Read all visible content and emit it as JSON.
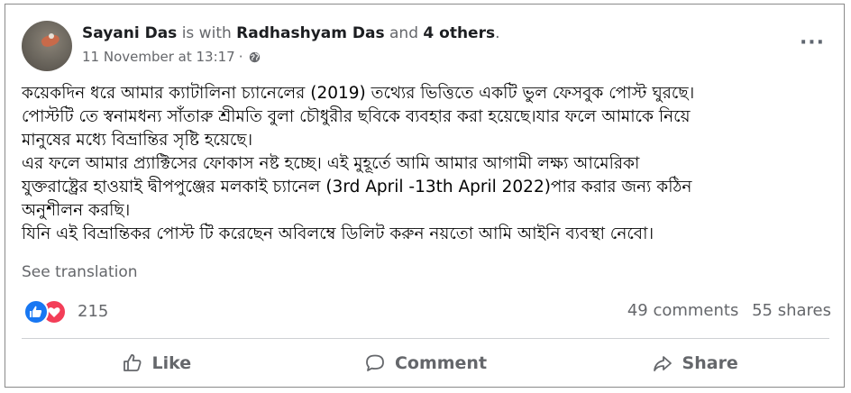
{
  "post": {
    "author": "Sayani Das",
    "with_text": "is with",
    "tagged_person": "Radhashyam Das",
    "and_text": "and",
    "others": "4 others",
    "period": ".",
    "timestamp": "11 November at 13:17",
    "separator": "·",
    "privacy_icon": "globe-icon",
    "body_lines": [
      "কয়েকদিন ধরে আমার ক্যাটালিনা চ্যানেলের (2019)  তথ্যের ভিত্তিতে একটি ভুল ফেসবুক পোস্ট ঘুরছে।",
      "পোস্টটি তে স্বনামধন্য সাঁতারু শ্রীমতি বুলা চৌধুরীর ছবিকে ব্যবহার করা হয়েছে।যার ফলে আমাকে নিয়ে",
      "মানুষের মধ্যে বিভ্রান্তির সৃষ্টি হয়েছে।",
      "এর ফলে আমার প্র্যাক্টিসের ফোকাস নষ্ট হচ্ছে। এই মুহূর্তে আমি আমার আগামী লক্ষ্য আমেরিকা",
      "যুক্তরাষ্ট্রের হাওয়াই দ্বীপপুঞ্জের মলকাই চ্যানেল (3rd April -13th April 2022)পার করার জন্য কঠিন",
      "অনুশীলন করছি।",
      "যিনি এই বিভ্রান্তিকর পোস্ট টি করেছেন অবিলম্বে ডিলিট করুন নয়তো আমি আইনি ব্যবস্থা নেবো।"
    ],
    "see_translation": "See translation",
    "reaction_count": "215",
    "reaction_icons": [
      "like-icon",
      "love-icon"
    ],
    "comments": "49 comments",
    "shares": "55 shares"
  },
  "actions": {
    "like": "Like",
    "comment": "Comment",
    "share": "Share"
  },
  "colors": {
    "like_blue": "#1877f2",
    "love_red": "#f33e58",
    "secondary_text": "#65676b"
  }
}
